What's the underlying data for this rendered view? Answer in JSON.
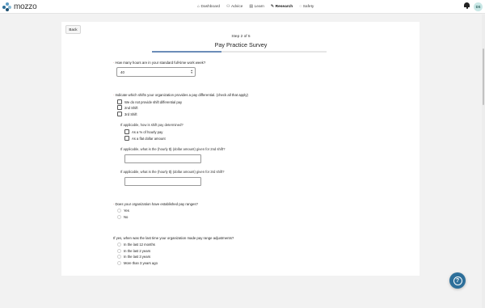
{
  "header": {
    "logo_text": "mozzo",
    "nav": [
      {
        "label": "Dashboard",
        "icon": "home-icon",
        "glyph": "⌂",
        "active": false
      },
      {
        "label": "Advice",
        "icon": "people-icon",
        "glyph": "⚇",
        "active": false
      },
      {
        "label": "Learn",
        "icon": "book-icon",
        "glyph": "▤",
        "active": false
      },
      {
        "label": "Research",
        "icon": "chart-icon",
        "glyph": "✎",
        "active": true
      },
      {
        "label": "Safety",
        "icon": "shield-icon",
        "glyph": "◌",
        "active": false
      }
    ],
    "avatar_initials": "DS"
  },
  "survey": {
    "back_label": "Back",
    "step_text": "Step 2 of 5",
    "title": "Pay Practice Survey",
    "progress_fraction": 0.4,
    "q1": {
      "label": "How many hours are in your standard full-time work week?",
      "value": "40"
    },
    "q2": {
      "label": "Indicate which shifts your organization provides a pay differential. (check all that apply)",
      "options": [
        "We do not provide shift differential pay",
        "2nd Shift",
        "3rd Shift"
      ]
    },
    "q2a": {
      "label": "If applicable, how is shift pay determined?",
      "options": [
        "As a % of hourly pay",
        "As a flat dollar amount"
      ]
    },
    "q2b": {
      "label": "If applicable, what is the (hourly $) (dollar amount) given for 2nd shift?",
      "value": ""
    },
    "q2c": {
      "label": "If applicable, what is the (hourly $) (dollar amount) given for 3rd shift?",
      "value": ""
    },
    "q3": {
      "label": "Does your organization have established pay ranges?",
      "options": [
        "Yes",
        "No"
      ]
    },
    "q4": {
      "label": "If yes, when was the last time your organization made pay range adjustments?",
      "options": [
        "In the last 12 months",
        "In the last 2 years",
        "In the last 3 years",
        "More than 3 years ago"
      ]
    }
  },
  "colors": {
    "accent": "#2d6f9a",
    "progress": "#6c8db8",
    "required": "#c0392b"
  }
}
